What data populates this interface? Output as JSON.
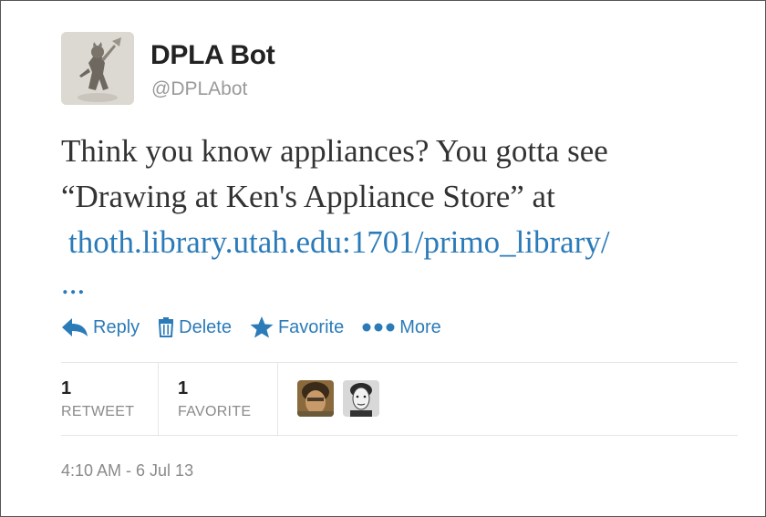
{
  "user": {
    "name": "DPLA Bot",
    "handle": "@DPLAbot"
  },
  "tweet": {
    "line1": "Think you know appliances? You gotta see",
    "line2": "“Drawing at Ken's Appliance Store” at",
    "link": "thoth.library.utah.edu:1701/primo_library/",
    "ellipsis": "..."
  },
  "actions": {
    "reply": "Reply",
    "delete": "Delete",
    "favorite": "Favorite",
    "more": "More"
  },
  "stats": {
    "retweets_count": "1",
    "retweets_label": "RETWEET",
    "favorites_count": "1",
    "favorites_label": "FAVORITE"
  },
  "timestamp": "4:10 AM - 6 Jul 13",
  "colors": {
    "link": "#2b7bb9",
    "text": "#333333",
    "muted": "#8a8a8a"
  },
  "icons": {
    "reply": "reply-arrow-icon",
    "delete": "trash-icon",
    "favorite": "star-icon",
    "more": "dots-icon"
  }
}
